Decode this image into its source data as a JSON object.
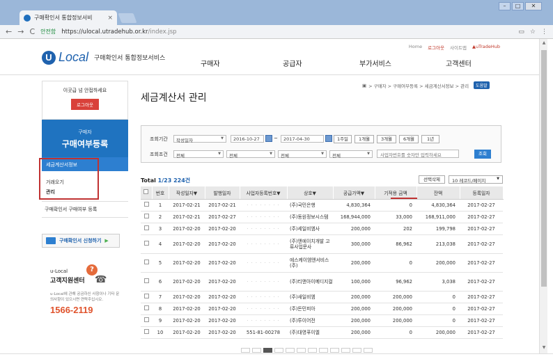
{
  "browser": {
    "tab_title": "구매확인서 통합정보서비",
    "tab_close": "×",
    "window_buttons": [
      "–",
      "□",
      "✕"
    ],
    "secure_label": "안전함",
    "url_host": "https://ulocal.utradehub.or.kr",
    "url_path": "/index.jsp",
    "nav": [
      "←",
      "→",
      "C"
    ]
  },
  "header": {
    "logo_letter": "U",
    "logo_word": "Local",
    "logo_sub": "구매확인서 통합정보서비스",
    "util_links": [
      "Home",
      "로그아웃",
      "사이트맵",
      "uTradeHub"
    ],
    "nav": [
      "구매자",
      "공급자",
      "부가서비스",
      "고객센터"
    ]
  },
  "sidebar": {
    "login_msg": "이곳급 넘 안접하세요",
    "logout_btn": "로그아웃",
    "banner_small": "구매자",
    "banner_big": "구매여부등록",
    "selected_item": "세금계산서정보",
    "items": [
      "거래오기",
      "관리"
    ],
    "item3": "구매확인서 구매여부 등록",
    "apply_btn": "구매확인서 신청하기",
    "cs_small": "u-Local",
    "cs_title": "고객지원센터",
    "cs_desc": "u-Local에 관해 궁금하신 사항이나 기타 문의사항이 있으시면 연락주십시오.",
    "cs_phone": "1566-2119"
  },
  "main": {
    "title": "세금계산서 관리",
    "breadcrumb": "> 구매자 > 구매여부등록 > 세금계산서정보 > 관리",
    "help": "도움말",
    "search": {
      "period_label": "조회기간",
      "period_type": "작성일자",
      "date_from": "2016-10-27",
      "tilde": "~",
      "date_to": "2017-04-30",
      "period_buttons": [
        "1주일",
        "1개월",
        "3개월",
        "6개월",
        "1년"
      ],
      "cond_label": "조회조건",
      "cond_selects": [
        "전체",
        "전체",
        "전체",
        "전체"
      ],
      "keyword_placeholder": "사업자번호를 숫자만 입력하세요",
      "search_btn": "조회"
    },
    "total_prefix": "Total",
    "total_value": "1/23 224건",
    "delete_btn": "선택삭제",
    "per_page": "10 레코드/페이지"
  },
  "table": {
    "headers": [
      "번호",
      "작성일자▼",
      "발행일자",
      "사업자등록번호▼",
      "상호▼",
      "공급가액▼",
      "기적용 금액",
      "잔액",
      "등록일자"
    ],
    "rows": [
      [
        "1",
        "2017-02-21",
        "2017-02-21",
        "· · · · · · · ·",
        "(주)국민은행",
        "4,830,364",
        "0",
        "4,830,364",
        "2017-02-27"
      ],
      [
        "2",
        "2017-02-21",
        "2017-02-27",
        "· · · · · · · ·",
        "(주)동원정보시스템",
        "168,944,000",
        "33,000",
        "168,911,000",
        "2017-02-27"
      ],
      [
        "3",
        "2017-02-20",
        "2017-02-20",
        "· · · · · · · ·",
        "(주)세일비엠사",
        "200,000",
        "202",
        "199,798",
        "2017-02-27"
      ],
      [
        "4",
        "2017-02-20",
        "2017-02-20",
        "· · · · · · · ·",
        "(주)앤에이치개발 고류사업문사",
        "300,000",
        "86,962",
        "213,038",
        "2017-02-27"
      ],
      [
        "5",
        "2017-02-20",
        "2017-02-20",
        "· · · · · · · ·",
        "에스케이엠앤서비스(주)",
        "200,000",
        "0",
        "200,000",
        "2017-02-27"
      ],
      [
        "6",
        "2017-02-20",
        "2017-02-20",
        "· · · · · · · ·",
        "(주)티앤아이메디지컬",
        "100,000",
        "96,962",
        "3,038",
        "2017-02-27"
      ],
      [
        "7",
        "2017-02-20",
        "2017-02-20",
        "· · · · · · · ·",
        "(주)새일비엠",
        "200,000",
        "200,000",
        "0",
        "2017-02-27"
      ],
      [
        "8",
        "2017-02-20",
        "2017-02-20",
        "· · · · · · · ·",
        "(주)돈민피아",
        "200,000",
        "200,000",
        "0",
        "2017-02-27"
      ],
      [
        "9",
        "2017-02-20",
        "2017-02-20",
        "· · · · · · · ·",
        "(주)투이어전",
        "200,000",
        "200,000",
        "0",
        "2017-02-27"
      ],
      [
        "10",
        "2017-02-20",
        "2017-02-20",
        "551-81-00278",
        "(주)대영푸이엘",
        "200,000",
        "0",
        "200,000",
        "2017-02-27"
      ]
    ]
  },
  "colors": {
    "brand_blue": "#1f62ae",
    "accent_red": "#c03232"
  }
}
